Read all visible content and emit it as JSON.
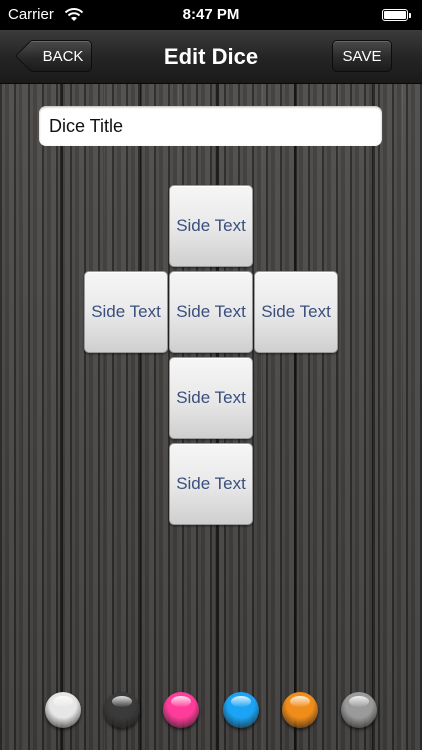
{
  "status_bar": {
    "carrier": "Carrier",
    "time": "8:47 PM",
    "wifi_icon": "wifi-icon",
    "battery_icon": "battery-icon"
  },
  "nav": {
    "title": "Edit Dice",
    "back_label": "BACK",
    "save_label": "SAVE"
  },
  "title_field": {
    "value": "Dice Title",
    "placeholder": ""
  },
  "faces": [
    {
      "label": "Side Text"
    },
    {
      "label": "Side Text"
    },
    {
      "label": "Side Text"
    },
    {
      "label": "Side Text"
    },
    {
      "label": "Side Text"
    },
    {
      "label": "Side Text"
    }
  ],
  "colors": [
    {
      "name": "white-orb",
      "hex": "#e6e6e6"
    },
    {
      "name": "black-orb",
      "hex": "#3a3a3a"
    },
    {
      "name": "pink-orb",
      "hex": "#ff3c9a"
    },
    {
      "name": "blue-orb",
      "hex": "#1ba4f5"
    },
    {
      "name": "orange-orb",
      "hex": "#f08c1a"
    },
    {
      "name": "gray-orb",
      "hex": "#9a9a9a"
    }
  ]
}
